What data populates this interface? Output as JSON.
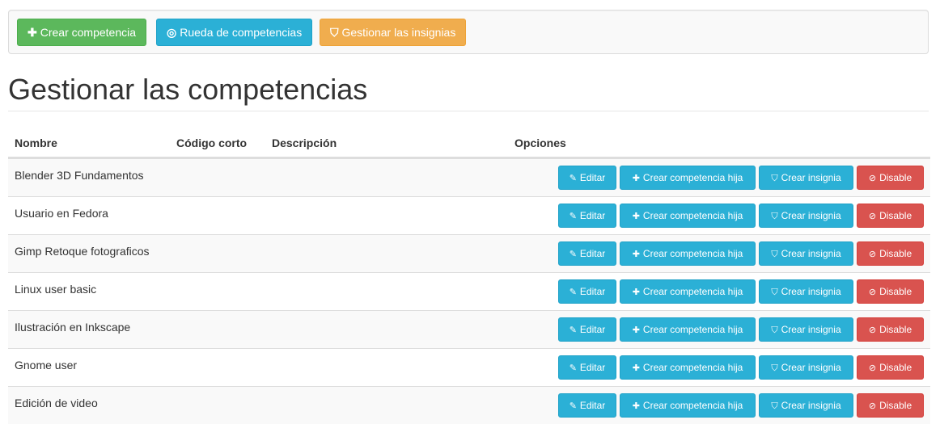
{
  "toolbar": {
    "create_label": "Crear competencia",
    "wheel_label": "Rueda de competencias",
    "badges_label": "Gestionar las insignias"
  },
  "page": {
    "title": "Gestionar las competencias"
  },
  "table": {
    "headers": {
      "name": "Nombre",
      "short_code": "Código corto",
      "description": "Descripción",
      "options": "Opciones"
    },
    "action_labels": {
      "edit": "Editar",
      "create_child": "Crear competencia hija",
      "create_badge": "Crear insignia",
      "disable": "Disable"
    },
    "rows": [
      {
        "name": "Blender 3D Fundamentos",
        "short_code": "",
        "description": ""
      },
      {
        "name": "Usuario en Fedora",
        "short_code": "",
        "description": ""
      },
      {
        "name": "Gimp Retoque fotograficos",
        "short_code": "",
        "description": ""
      },
      {
        "name": "Linux user basic",
        "short_code": "",
        "description": ""
      },
      {
        "name": "Ilustración en Inkscape",
        "short_code": "",
        "description": ""
      },
      {
        "name": "Gnome user",
        "short_code": "",
        "description": ""
      },
      {
        "name": "Edición de video",
        "short_code": "",
        "description": ""
      }
    ]
  },
  "icons": {
    "plus": "plus-icon",
    "wheel": "bullseye-icon",
    "shield": "shield-icon",
    "edit": "edit-icon",
    "ban": "ban-icon"
  },
  "colors": {
    "success": "#5cb85c",
    "info": "#2bb0d6",
    "warning": "#f0ad4e",
    "danger": "#d9534f"
  }
}
